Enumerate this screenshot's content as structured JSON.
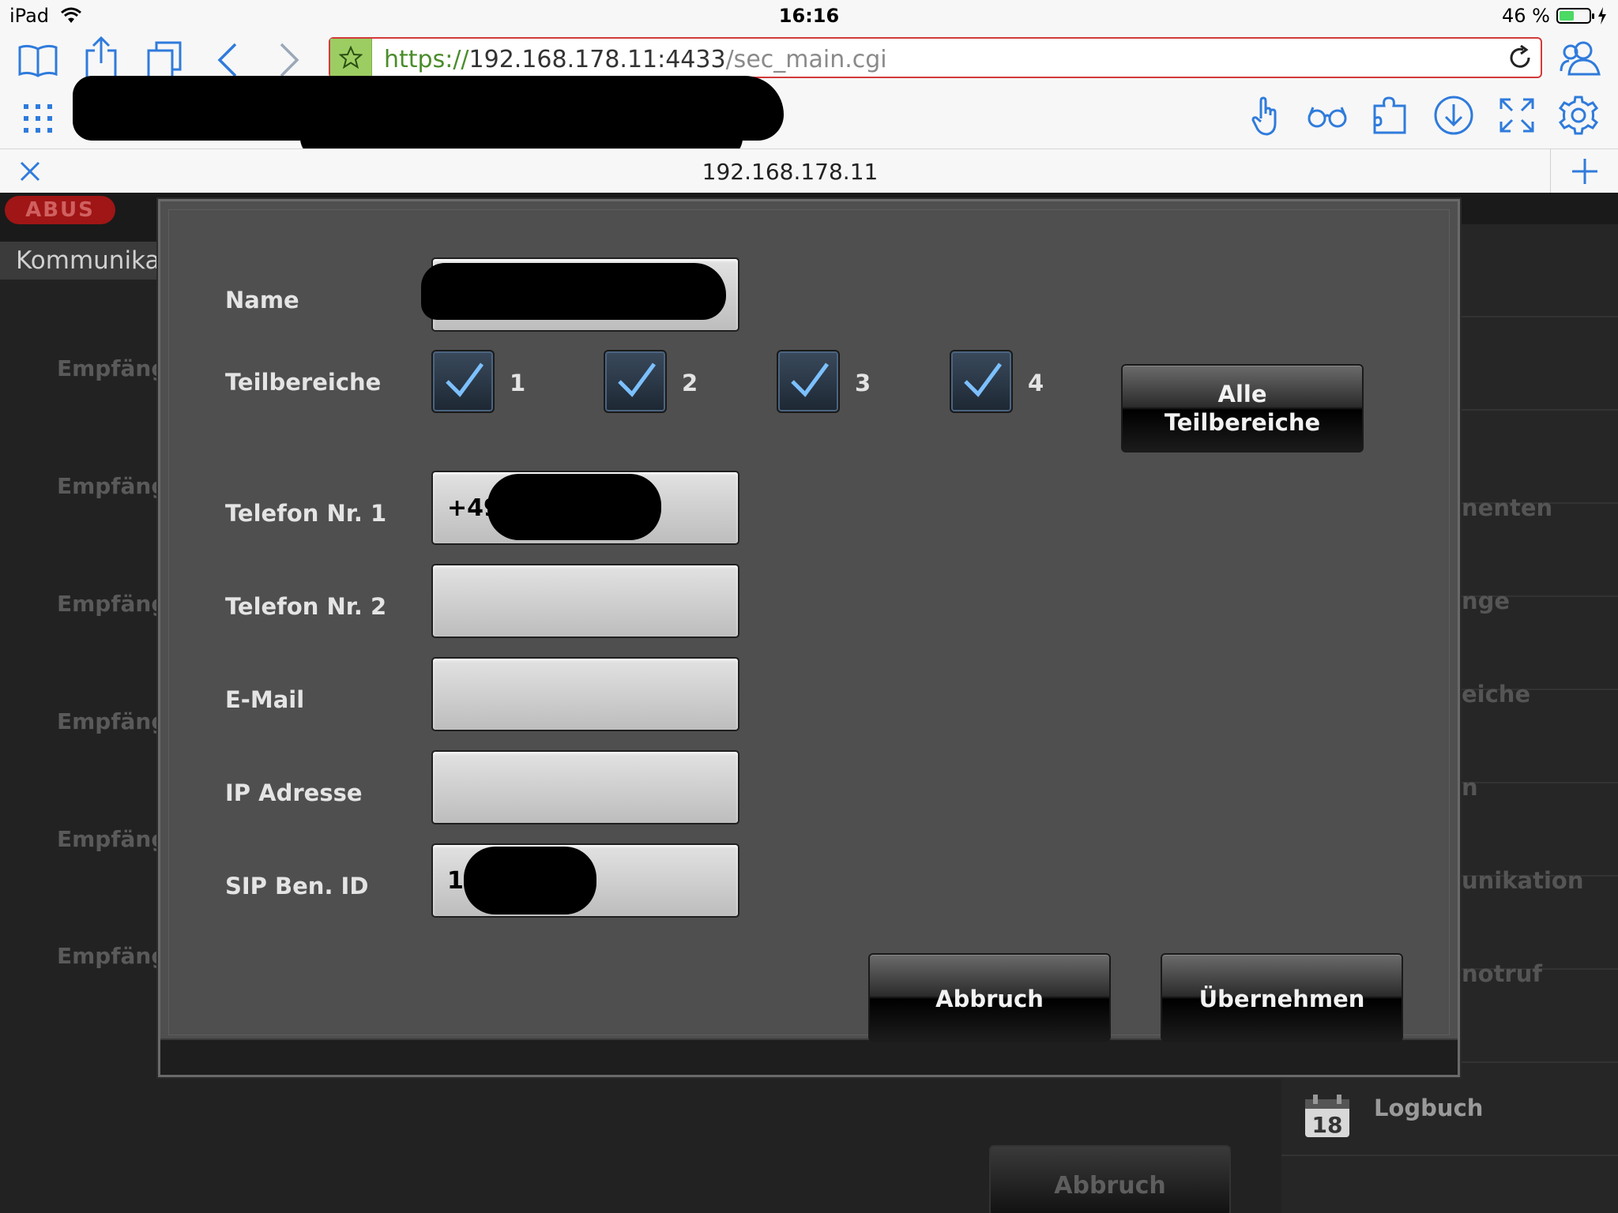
{
  "status_bar": {
    "device": "iPad",
    "time": "16:16",
    "battery": "46 %"
  },
  "browser": {
    "url_scheme": "https://",
    "url_host": "192.168.178.11:4433",
    "url_path": "/sec_main.cgi",
    "tab_title": "192.168.178.11"
  },
  "background_app": {
    "logo": "ABUS",
    "section_title": "Kommunika",
    "receiver_rows": [
      "Empfäng",
      "Empfäng",
      "Empfäng",
      "Empfäng",
      "Empfäng",
      "Empfäng"
    ],
    "right_menu": [
      "nenten",
      "nge",
      "eiche",
      "n",
      "unikation",
      "notruf",
      "",
      "Logbuch"
    ],
    "calendar_day": "18",
    "cancel_label": "Abbruch"
  },
  "dialog": {
    "labels": {
      "name": "Name",
      "areas": "Teilbereiche",
      "phone1": "Telefon Nr. 1",
      "phone2": "Telefon Nr. 2",
      "email": "E-Mail",
      "ip": "IP Adresse",
      "sip": "SIP Ben. ID"
    },
    "values": {
      "name": "",
      "phone1": "+49              21",
      "phone2": "",
      "email": "",
      "ip": "",
      "sip": "16        0"
    },
    "areas": [
      {
        "label": "1",
        "checked": true
      },
      {
        "label": "2",
        "checked": true
      },
      {
        "label": "3",
        "checked": true
      },
      {
        "label": "4",
        "checked": true
      }
    ],
    "all_areas_line1": "Alle",
    "all_areas_line2": "Teilbereiche",
    "cancel_label": "Abbruch",
    "apply_label": "Übernehmen"
  },
  "colors": {
    "url_border": "#d33a3a",
    "star_bg": "#9ccd62",
    "ios_blue": "#2f7bdc",
    "checkbox_check": "#7cc0ff"
  }
}
